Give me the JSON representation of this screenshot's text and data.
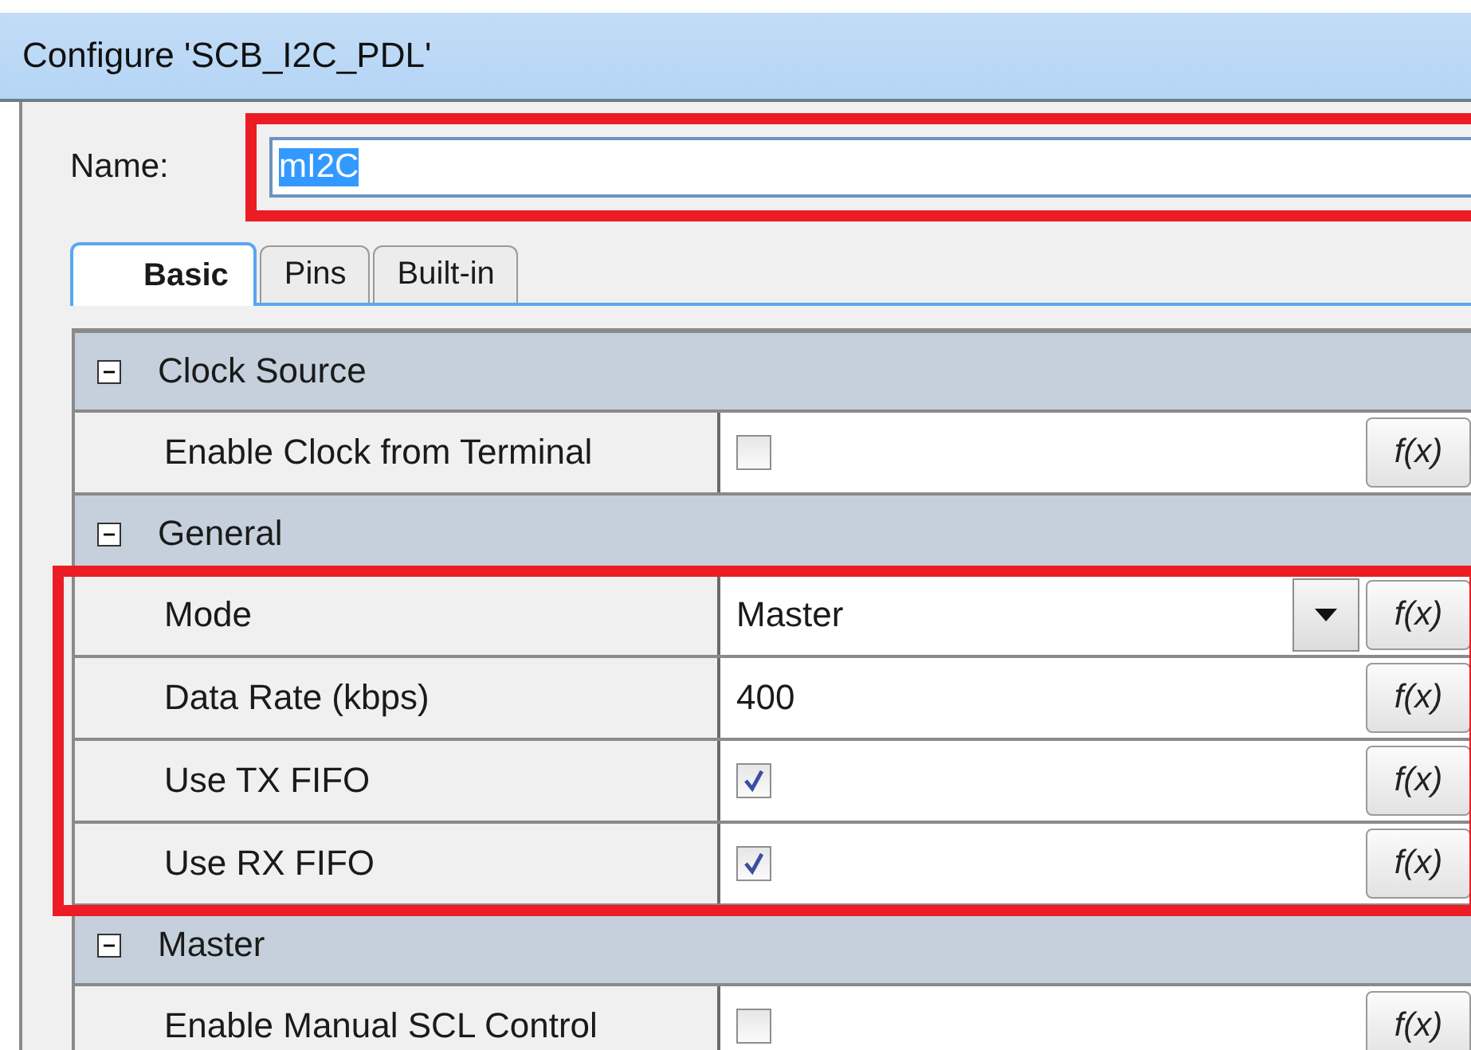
{
  "window": {
    "title": "Configure 'SCB_I2C_PDL'"
  },
  "name_field": {
    "label": "Name:",
    "value": "mI2C",
    "text_selected": true,
    "highlighted": true
  },
  "tabs": [
    {
      "label": "Basic",
      "selected": true
    },
    {
      "label": "Pins",
      "selected": false
    },
    {
      "label": "Built-in",
      "selected": false
    }
  ],
  "sections": [
    {
      "title": "Clock Source",
      "expanded": true,
      "rows": [
        {
          "label": "Enable Clock from Terminal",
          "kind": "checkbox",
          "checked": false,
          "highlighted": false,
          "fx": "f(x)"
        }
      ]
    },
    {
      "title": "General",
      "expanded": true,
      "rows": [
        {
          "label": "Mode",
          "kind": "dropdown",
          "value": "Master",
          "highlighted": true,
          "fx": "f(x)"
        },
        {
          "label": "Data Rate (kbps)",
          "kind": "text",
          "value": "400",
          "highlighted": true,
          "fx": "f(x)"
        },
        {
          "label": "Use TX FIFO",
          "kind": "checkbox",
          "checked": true,
          "highlighted": true,
          "fx": "f(x)"
        },
        {
          "label": "Use RX FIFO",
          "kind": "checkbox",
          "checked": true,
          "highlighted": true,
          "fx": "f(x)"
        }
      ]
    },
    {
      "title": "Master",
      "expanded": true,
      "rows": [
        {
          "label": "Enable Manual SCL Control",
          "kind": "checkbox",
          "checked": false,
          "highlighted": false,
          "fx": "f(x)"
        }
      ]
    }
  ]
}
